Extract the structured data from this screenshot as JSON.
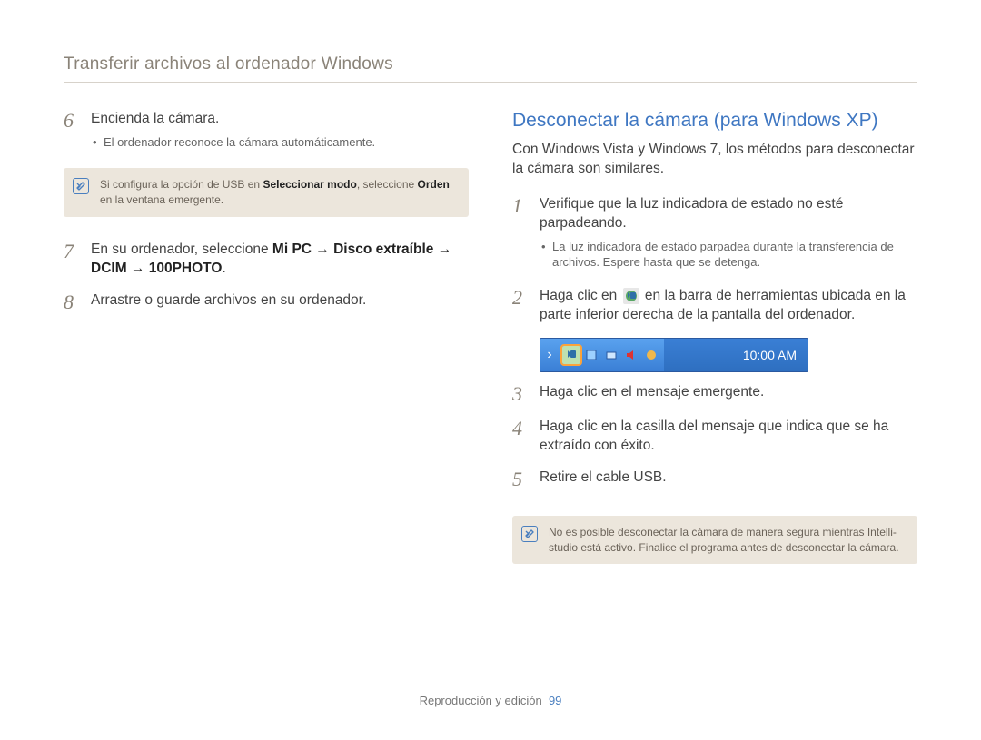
{
  "header": "Transferir archivos al ordenador Windows",
  "left": {
    "step6": {
      "num": "6",
      "text": "Encienda la cámara.",
      "bullets": [
        "El ordenador reconoce la cámara automáticamente."
      ]
    },
    "note1": {
      "pre": "Si configura la opción de USB en ",
      "b1": "Seleccionar modo",
      "mid": ", seleccione ",
      "b2": "Orden",
      "post": " en la ventana emergente."
    },
    "step7": {
      "num": "7",
      "pre": "En su ordenador, seleccione ",
      "b1": "Mi PC",
      "arrow1": " → ",
      "b2": "Disco extraíble",
      "arrow2": " → ",
      "b3": "DCIM",
      "arrow3": " → ",
      "b4": "100PHOTO",
      "post": "."
    },
    "step8": {
      "num": "8",
      "text": "Arrastre o guarde archivos en su ordenador."
    }
  },
  "right": {
    "title": "Desconectar la cámara (para Windows XP)",
    "intro": "Con Windows Vista y Windows 7, los métodos para desconectar la cámara son similares.",
    "step1": {
      "num": "1",
      "text": "Verifique que la luz indicadora de estado no esté parpadeando.",
      "bullets": [
        "La luz indicadora de estado parpadea durante la transferencia de archivos. Espere hasta que se detenga."
      ]
    },
    "step2": {
      "num": "2",
      "pre": "Haga clic en ",
      "post": " en la barra de herramientas ubicada en la parte inferior derecha de la pantalla del ordenador."
    },
    "taskbar_time": "10:00 AM",
    "step3": {
      "num": "3",
      "text": "Haga clic en el mensaje emergente."
    },
    "step4": {
      "num": "4",
      "text": "Haga clic en la casilla del mensaje que indica que se ha extraído con éxito."
    },
    "step5": {
      "num": "5",
      "text": "Retire el cable USB."
    },
    "note2": "No es posible desconectar la cámara de manera segura mientras Intelli-studio está activo. Finalice el programa antes de desconectar la cámara."
  },
  "footer": {
    "label": "Reproducción y edición",
    "page": "99"
  }
}
